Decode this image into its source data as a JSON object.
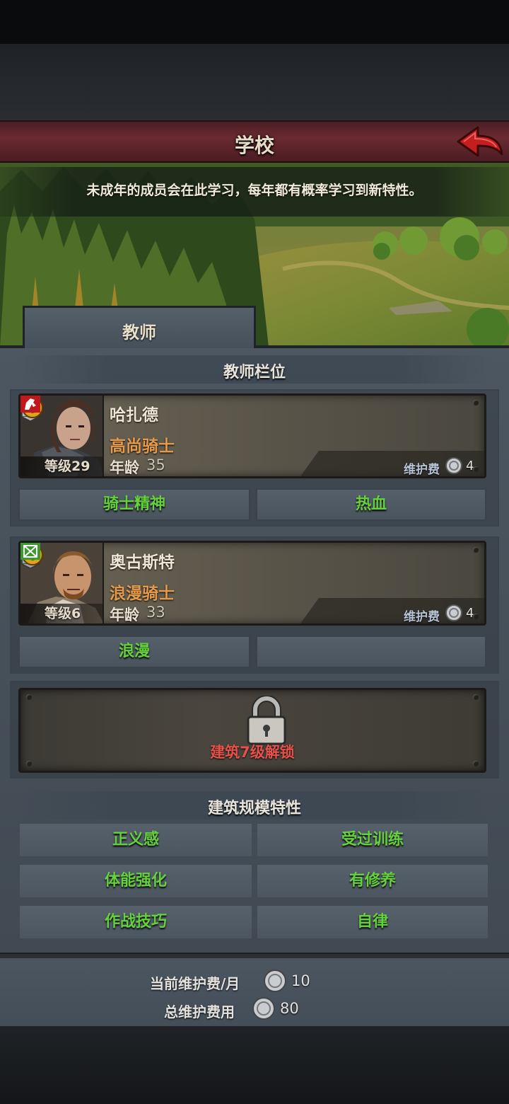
{
  "header": {
    "title": "学校",
    "description": "未成年的成员会在此学习，每年都有概率学习到新特性。"
  },
  "tabs": [
    {
      "label": "教师"
    }
  ],
  "teacher_section": {
    "title": "教师栏位",
    "teachers": [
      {
        "name": "哈扎德",
        "class": "高尚骑士",
        "age_label": "年龄",
        "age": "35",
        "level": "等级29",
        "upkeep_label": "维护费",
        "upkeep": "4",
        "traits": [
          "骑士精神",
          "热血"
        ]
      },
      {
        "name": "奥古斯特",
        "class": "浪漫骑士",
        "age_label": "年龄",
        "age": "33",
        "level": "等级6",
        "upkeep_label": "维护费",
        "upkeep": "4",
        "traits": [
          "浪漫",
          ""
        ]
      }
    ],
    "locked_slot": "建筑7级解锁"
  },
  "building_section": {
    "title": "建筑规模特性",
    "traits": [
      "正义感",
      "受过训练",
      "体能强化",
      "有修养",
      "作战技巧",
      "自律"
    ]
  },
  "footer": {
    "monthly_label": "当前维护费/月",
    "monthly_value": "10",
    "total_label": "总维护费用",
    "total_value": "80"
  },
  "colors": {
    "trait_green": "#64d13d",
    "class_orange": "#e69b4a",
    "lock_red": "#e4524a",
    "title_bar": "#6a2a31"
  },
  "icons": [
    "back-arrow-icon",
    "swap-icon",
    "lock-icon",
    "silver-coin-icon",
    "knight-class-icon",
    "rank-banner-icon"
  ]
}
